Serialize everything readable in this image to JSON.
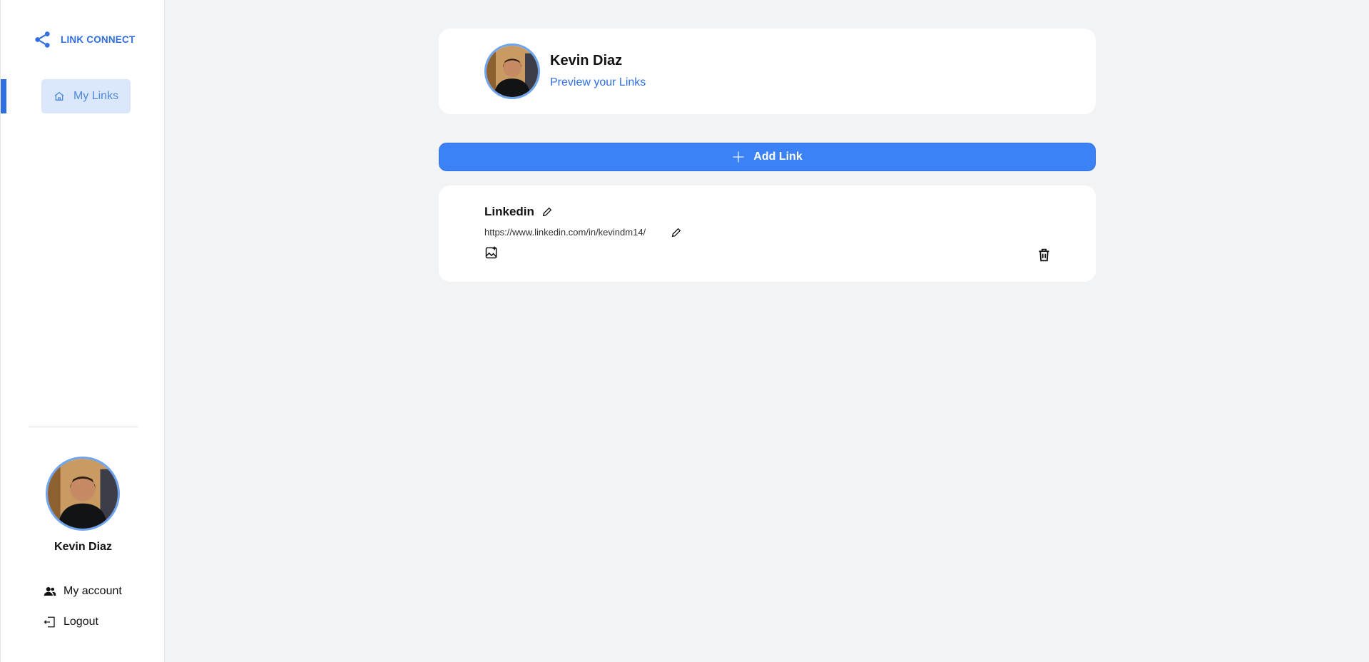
{
  "app": {
    "name": "LINK CONNECT"
  },
  "sidebar": {
    "nav_items": [
      {
        "label": "My Links",
        "icon": "home-icon",
        "active": true
      }
    ],
    "user": {
      "name": "Kevin Diaz"
    },
    "menu": [
      {
        "label": "My account",
        "icon": "users-icon"
      },
      {
        "label": "Logout",
        "icon": "logout-icon"
      }
    ]
  },
  "profile": {
    "name": "Kevin Diaz",
    "preview_label": "Preview your Links"
  },
  "actions": {
    "add_link_label": "Add Link"
  },
  "links": [
    {
      "title": "Linkedin",
      "url": "https://www.linkedin.com/in/kevindm14/"
    }
  ],
  "colors": {
    "accent": "#2f6fe0",
    "button": "#3b82f6",
    "nav_bg": "#dbe8fb",
    "page_bg": "#f2f3f5"
  }
}
